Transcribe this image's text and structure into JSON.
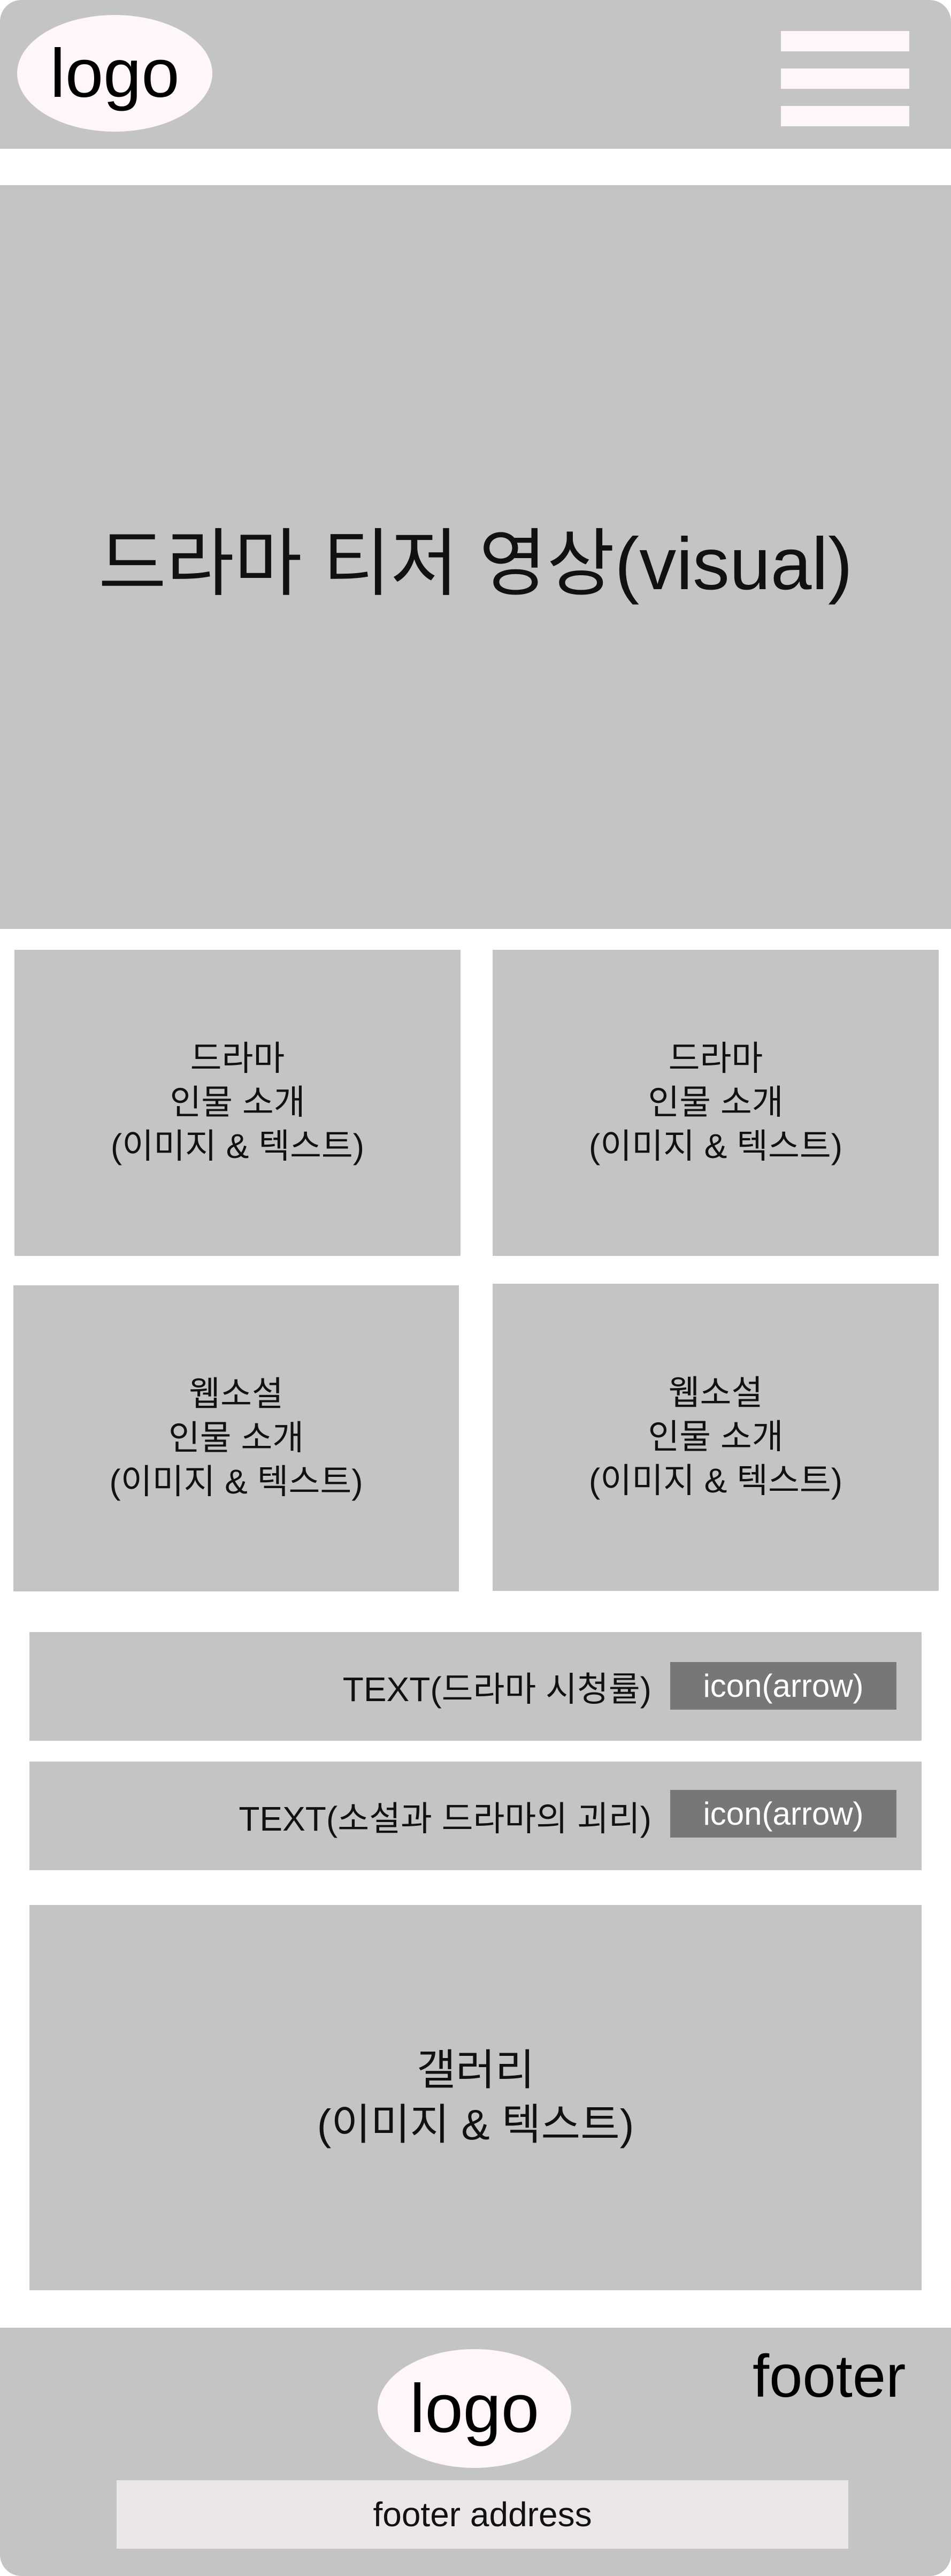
{
  "header": {
    "logo": "logo",
    "menu_icon": "hamburger-menu-icon"
  },
  "visual": {
    "text": "드라마 티저 영상(visual)"
  },
  "cards": [
    {
      "text": "드라마\n인물 소개\n(이미지 & 텍스트)"
    },
    {
      "text": "드라마\n인물 소개\n(이미지 & 텍스트)"
    },
    {
      "text": "웹소설\n인물 소개\n(이미지 & 텍스트)"
    },
    {
      "text": "웹소설\n인물 소개\n(이미지 & 텍스트)"
    }
  ],
  "rows": [
    {
      "text": "TEXT(드라마 시청률)",
      "button": "icon(arrow)"
    },
    {
      "text": "TEXT(소설과 드라마의 괴리)",
      "button": "icon(arrow)"
    }
  ],
  "gallery": {
    "text": "갤러리\n(이미지 & 텍스트)"
  },
  "footer": {
    "label": "footer",
    "logo": "logo",
    "address": "footer address"
  },
  "colors": {
    "block": "#c4c4c4",
    "logo_bg": "#fff7f7",
    "button_bg": "#797676",
    "address_bg": "#ece7e7"
  }
}
